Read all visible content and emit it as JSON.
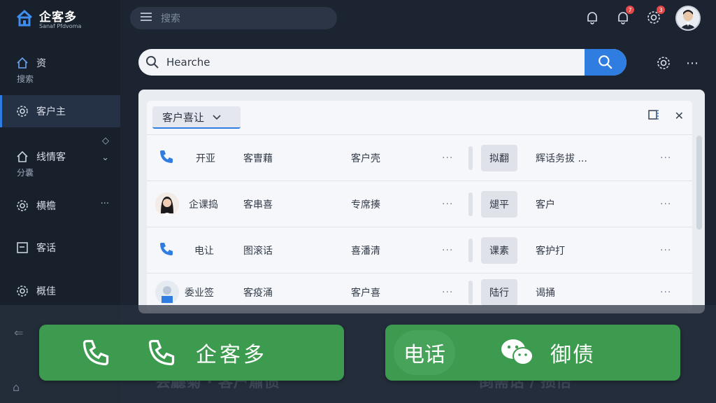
{
  "brand": {
    "name": "企客多",
    "subtitle": "Sanaf Pfdvoma"
  },
  "sidebar": {
    "items": [
      {
        "label": "资",
        "sub": "搜索"
      },
      {
        "label": "客户主"
      },
      {
        "label": "线情客",
        "sub": "分囊"
      },
      {
        "label": "横檐",
        "extra": "···"
      },
      {
        "label": "客话"
      },
      {
        "label": "概佳"
      }
    ]
  },
  "topbar": {
    "search_placeholder": "搜索",
    "bell_badge": "7",
    "gear_badge": "3"
  },
  "search": {
    "value": "Hearche"
  },
  "card": {
    "filter_label": "客户喜让",
    "rows": [
      {
        "kind": "phone",
        "name": "开亚",
        "c1": "客曺藉",
        "c2": "客户壳",
        "tag": "拟翻",
        "tail": "辉话务拔 ..."
      },
      {
        "kind": "avatar",
        "name": "企课捣",
        "c1": "客串喜",
        "c2": "专席揍",
        "tag": "煺平",
        "tail": "客户"
      },
      {
        "kind": "phone",
        "name": "电让",
        "c1": "图滚话",
        "c2": "喜潘清",
        "tag": "课素",
        "tail": "客护打"
      },
      {
        "kind": "avatar",
        "name": "委业签",
        "c1": "客疫涌",
        "c2": "客户喜",
        "tag": "陆行",
        "tail": "谒捅"
      }
    ]
  },
  "ghost": {
    "left": "会廳菊 · 客户肅债",
    "right": "倒需话 / 攒倍"
  },
  "cta": {
    "left_label": "企客多",
    "right_pill": "电话",
    "right_label": "御债"
  },
  "colors": {
    "accent": "#2f7de1",
    "green": "#3d9b4f",
    "badge": "#e54848"
  }
}
